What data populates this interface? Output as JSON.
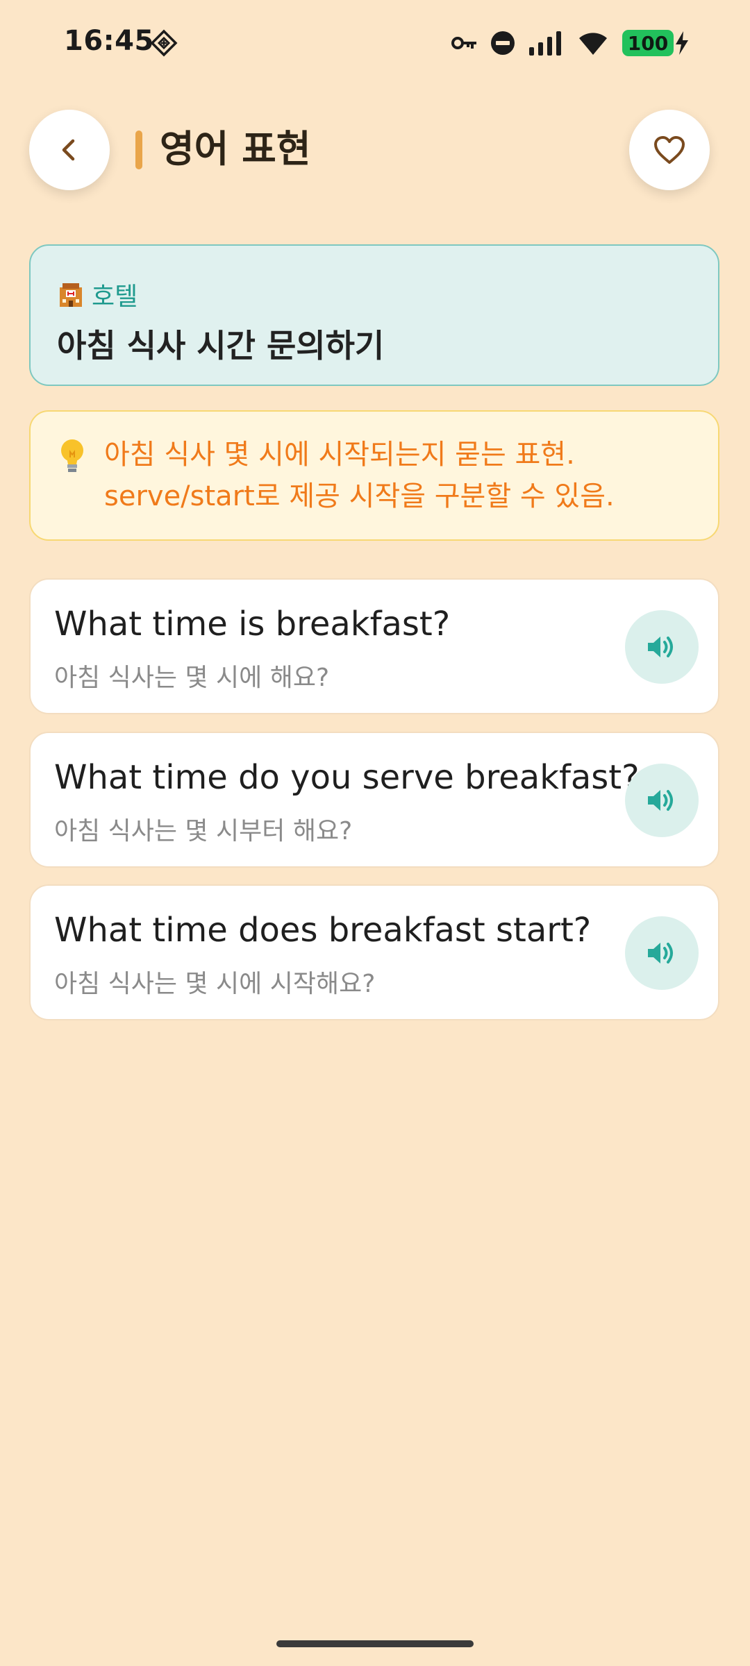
{
  "status_bar": {
    "time": "16:45",
    "battery": "100",
    "left_icon": "location-diamond-icon",
    "right_icons": [
      "vpn-key-icon",
      "do-not-disturb-icon",
      "signal-icon",
      "wifi-icon",
      "battery-icon"
    ]
  },
  "header": {
    "title": "영어 표현",
    "back_icon": "chevron-left-icon",
    "favorite_icon": "heart-icon"
  },
  "category": {
    "icon": "hotel-icon",
    "name": "호텔",
    "scenario": "아침 식사 시간 문의하기"
  },
  "tip": {
    "icon": "lightbulb-icon",
    "text": "아침 식사 몇 시에 시작되는지 묻는 표현. serve/start로 제공 시작을 구분할 수 있음."
  },
  "phrases": [
    {
      "english": "What time is breakfast?",
      "korean": "아침 식사는 몇 시에 해요?"
    },
    {
      "english": "What time do you serve breakfast?",
      "korean": "아침 식사는 몇 시부터 해요?"
    },
    {
      "english": "What time does breakfast start?",
      "korean": "아침 식사는 몇 시에 시작해요?"
    }
  ],
  "colors": {
    "background": "#fce6c8",
    "accent_orange": "#e9a54a",
    "teal": "#1f9a8e",
    "tip_text": "#f07a1a",
    "battery_green": "#22c15c"
  }
}
